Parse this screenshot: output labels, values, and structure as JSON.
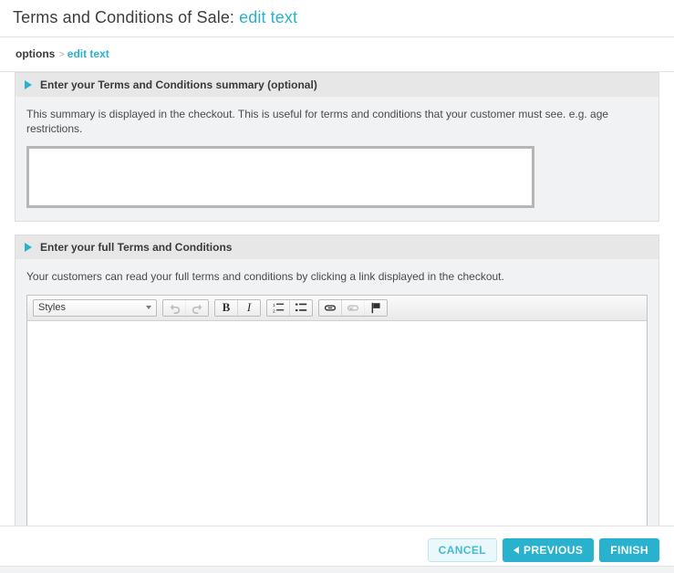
{
  "header": {
    "title_prefix": "Terms and Conditions of Sale:",
    "title_link": "edit text"
  },
  "breadcrumb": {
    "current": "options",
    "separator": ">",
    "link": "edit text"
  },
  "sections": [
    {
      "heading": "Enter your Terms and Conditions summary (optional)",
      "description": "This summary is displayed in the checkout. This is useful for terms and conditions that your customer must see. e.g. age restrictions.",
      "textarea_value": "",
      "textarea_placeholder": ""
    },
    {
      "heading": "Enter your full Terms and Conditions",
      "description": "Your customers can read your full terms and conditions by clicking a link displayed in the checkout.",
      "editor_value": ""
    }
  ],
  "editor": {
    "styles_label": "Styles",
    "buttons": {
      "undo": "undo-icon",
      "redo": "redo-icon",
      "bold": "B",
      "italic": "I",
      "numbered_list": "numbered-list-icon",
      "bulleted_list": "bulleted-list-icon",
      "link": "link-icon",
      "unlink": "unlink-icon",
      "anchor": "anchor-flag-icon"
    }
  },
  "footer": {
    "cancel": "CANCEL",
    "previous": "PREVIOUS",
    "finish": "FINISH"
  },
  "colors": {
    "accent": "#29b2cd",
    "section_header_bg": "#e7e7e7",
    "section_body_bg": "#f1f2f3"
  }
}
